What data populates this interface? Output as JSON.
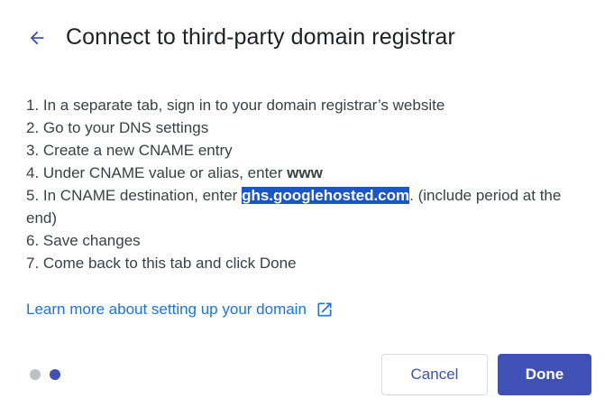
{
  "dialog": {
    "title": "Connect to third-party domain registrar",
    "back_icon": "arrow-back-icon"
  },
  "steps": [
    {
      "prefix": "1. In a separate tab, sign in to your domain registrar’s website"
    },
    {
      "prefix": "2. Go to your DNS settings"
    },
    {
      "prefix": "3. Create a new CNAME entry"
    },
    {
      "prefix": "4. Under CNAME value or alias, enter ",
      "bold": "www"
    },
    {
      "prefix": "5. In CNAME destination, enter ",
      "highlight": "ghs.googlehosted.com",
      "suffix": ". (include period at the end)"
    },
    {
      "prefix": "6. Save changes"
    },
    {
      "prefix": "7. Come back to this tab and click Done"
    }
  ],
  "learn_more": {
    "label": "Learn more about setting up your domain",
    "icon": "open-in-new-icon"
  },
  "pagination": {
    "total": 2,
    "current": 2
  },
  "buttons": {
    "cancel_label": "Cancel",
    "done_label": "Done"
  },
  "colors": {
    "accent": "#3f51b5",
    "link": "#1a73e8",
    "highlight_bg": "#1a56c9"
  }
}
